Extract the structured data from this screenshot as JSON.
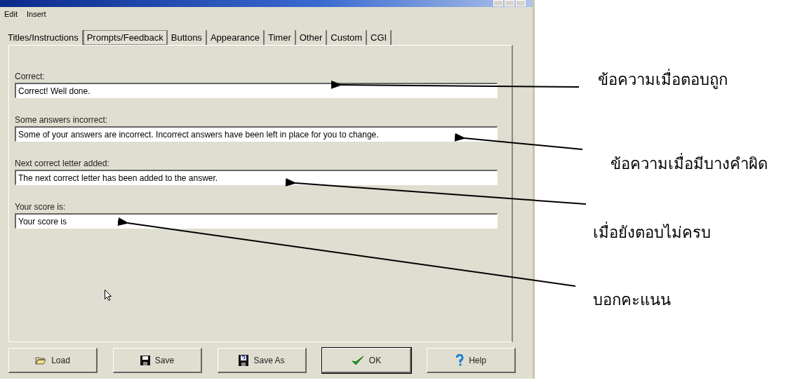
{
  "window": {
    "menu": [
      "Edit",
      "Insert"
    ],
    "tabs": [
      {
        "label": "Titles/Instructions",
        "selected": false
      },
      {
        "label": "Prompts/Feedback",
        "selected": true
      },
      {
        "label": "Buttons",
        "selected": false
      },
      {
        "label": "Appearance",
        "selected": false
      },
      {
        "label": "Timer",
        "selected": false
      },
      {
        "label": "Other",
        "selected": false
      },
      {
        "label": "Custom",
        "selected": false
      },
      {
        "label": "CGI",
        "selected": false
      }
    ],
    "fields": [
      {
        "label": "Correct:",
        "value": "Correct! Well done."
      },
      {
        "label": "Some answers incorrect:",
        "value": "Some of your answers are incorrect. Incorrect answers have been left in place for you to change."
      },
      {
        "label": "Next correct letter added:",
        "value": "The next correct letter has been added to the answer."
      },
      {
        "label": "Your score is:",
        "value": "Your score is"
      }
    ],
    "buttons": [
      {
        "label": "Load",
        "default": false
      },
      {
        "label": "Save",
        "default": false
      },
      {
        "label": "Save As",
        "default": false
      },
      {
        "label": "OK",
        "default": true
      },
      {
        "label": "Help",
        "default": false
      }
    ]
  },
  "annotations": [
    "ข้อความเมื่อตอบถูก",
    "ข้อความเมื่อมีบางคำผิด",
    "เมื่อยังตอบไม่ครบ",
    "บอกคะแนน"
  ]
}
